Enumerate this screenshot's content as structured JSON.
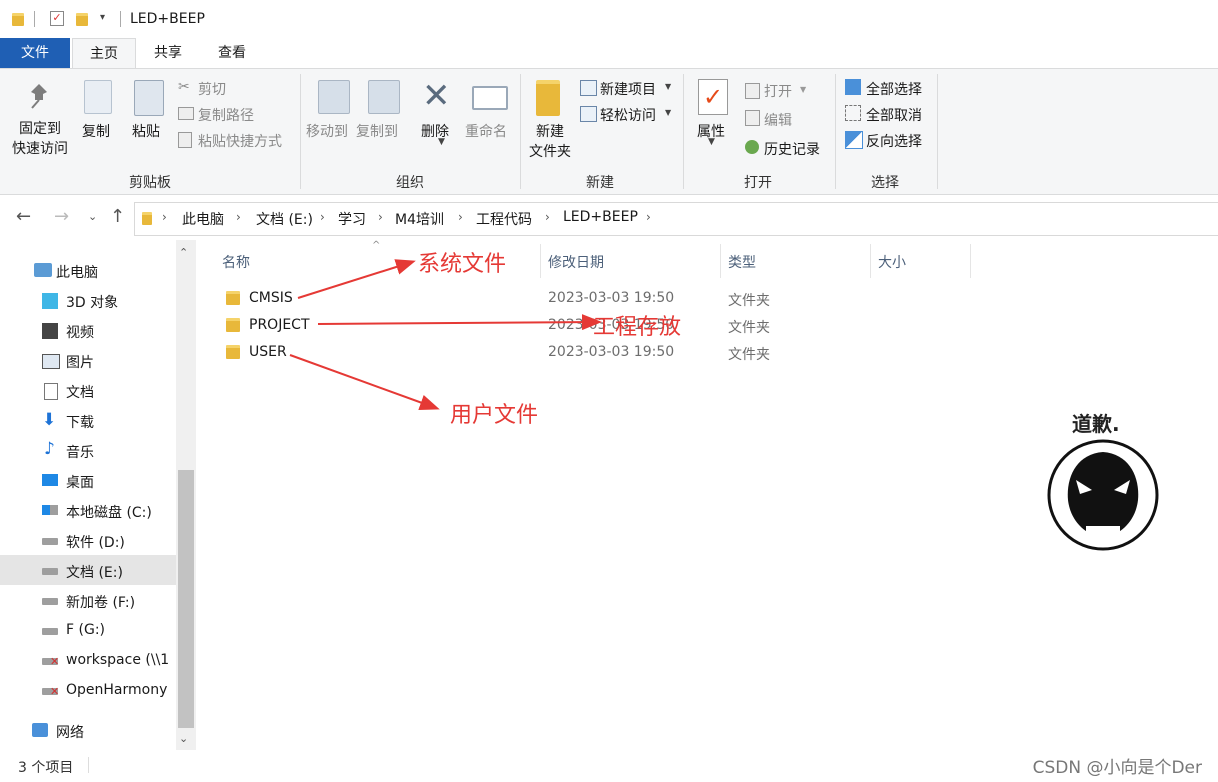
{
  "window": {
    "title": "LED+BEEP"
  },
  "tabs": [
    {
      "label": "文件"
    },
    {
      "label": "主页"
    },
    {
      "label": "共享"
    },
    {
      "label": "查看"
    }
  ],
  "ribbon": {
    "clipboard": {
      "pin_line1": "固定到",
      "pin_line2": "快速访问",
      "copy": "复制",
      "paste": "粘贴",
      "cut": "剪切",
      "copy_path": "复制路径",
      "paste_shortcut": "粘贴快捷方式",
      "label": "剪贴板"
    },
    "organize": {
      "move_to": "移动到",
      "copy_to": "复制到",
      "delete": "删除",
      "rename": "重命名",
      "label": "组织"
    },
    "new": {
      "new_folder_line1": "新建",
      "new_folder_line2": "文件夹",
      "new_item": "新建项目",
      "easy_access": "轻松访问",
      "label": "新建"
    },
    "open": {
      "properties": "属性",
      "open": "打开",
      "edit": "编辑",
      "history": "历史记录",
      "label": "打开"
    },
    "select": {
      "select_all": "全部选择",
      "select_none": "全部取消",
      "invert": "反向选择",
      "label": "选择"
    }
  },
  "breadcrumb": [
    "此电脑",
    "文档 (E:)",
    "学习",
    "M4培训",
    "工程代码",
    "LED+BEEP"
  ],
  "sidebar": {
    "items": [
      {
        "label": "此电脑",
        "icon": "computer-icon"
      },
      {
        "label": "3D 对象",
        "icon": "cube-icon"
      },
      {
        "label": "视频",
        "icon": "video-icon"
      },
      {
        "label": "图片",
        "icon": "picture-icon"
      },
      {
        "label": "文档",
        "icon": "document-icon"
      },
      {
        "label": "下载",
        "icon": "download-icon"
      },
      {
        "label": "音乐",
        "icon": "music-icon"
      },
      {
        "label": "桌面",
        "icon": "desktop-icon"
      },
      {
        "label": "本地磁盘 (C:)",
        "icon": "windows-drive-icon"
      },
      {
        "label": "软件 (D:)",
        "icon": "drive-icon"
      },
      {
        "label": "文档 (E:)",
        "icon": "drive-icon"
      },
      {
        "label": "新加卷 (F:)",
        "icon": "drive-icon"
      },
      {
        "label": "F (G:)",
        "icon": "drive-icon"
      },
      {
        "label": "workspace (\\\\1",
        "icon": "network-drive-disconnected-icon"
      },
      {
        "label": "OpenHarmony",
        "icon": "network-drive-disconnected-icon"
      },
      {
        "label": "网络",
        "icon": "network-icon"
      }
    ]
  },
  "columns": {
    "name": "名称",
    "date": "修改日期",
    "type": "类型",
    "size": "大小"
  },
  "files": [
    {
      "name": "CMSIS",
      "date": "2023-03-03 19:50",
      "type": "文件夹"
    },
    {
      "name": "PROJECT",
      "date": "2023-03-03 19:50",
      "type": "文件夹"
    },
    {
      "name": "USER",
      "date": "2023-03-03 19:50",
      "type": "文件夹"
    }
  ],
  "annotations": {
    "system_files": "系统文件",
    "project_storage": "工程存放",
    "user_files": "用户文件"
  },
  "sticker": {
    "caption": "道歉."
  },
  "status": {
    "item_count": "3 个项目"
  },
  "watermark": "CSDN @小向是个Der",
  "colors": {
    "file_tab": "#1f5fb4",
    "annotation": "#e53935",
    "folder": "#e8b83a"
  }
}
